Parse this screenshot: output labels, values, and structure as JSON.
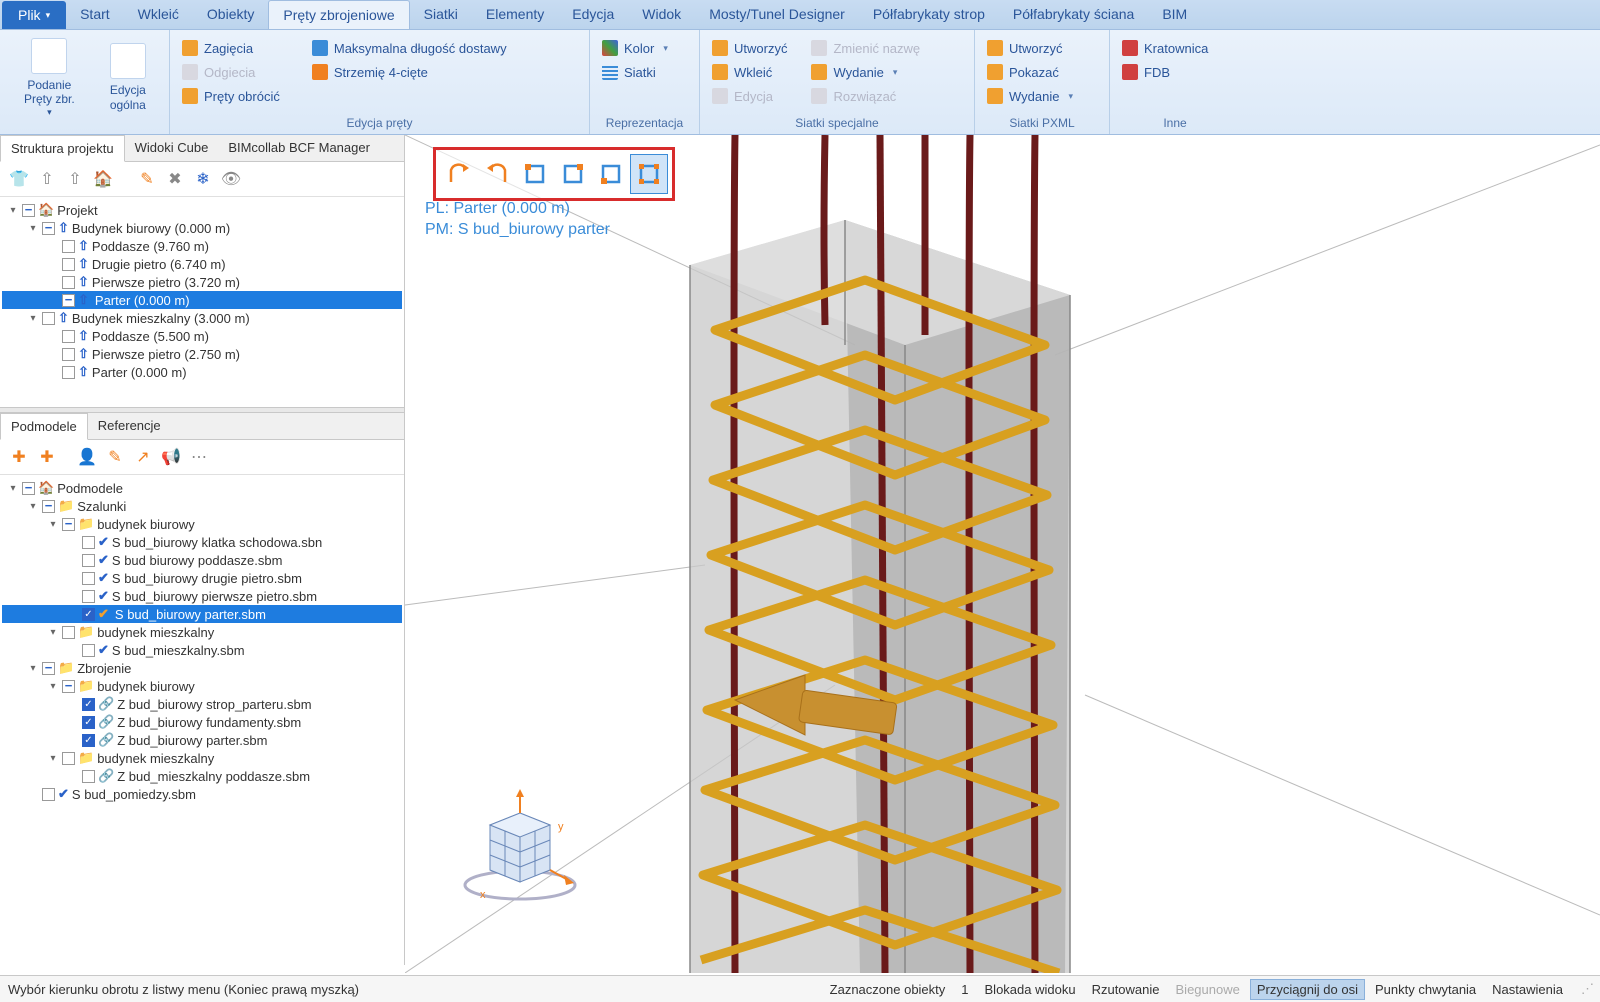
{
  "ribbon": {
    "file": "Plik",
    "tabs": [
      "Start",
      "Wkleić",
      "Obiekty",
      "Pręty zbrojeniowe",
      "Siatki",
      "Elementy",
      "Edycja",
      "Widok",
      "Mosty/Tunel Designer",
      "Półfabrykaty strop",
      "Półfabrykaty ściana",
      "BIM"
    ],
    "active_tab": 3,
    "groups": {
      "g1": {
        "label": "",
        "btn1": "Podanie\nPręty zbr.",
        "btn2": "Edycja\nogólna"
      },
      "g2": {
        "label": "Edycja pręty",
        "a": "Zagięcia",
        "b": "Odgiecia",
        "c": "Pręty obrócić",
        "d": "Maksymalna długość dostawy",
        "e": "Strzemię 4-cięte"
      },
      "g3": {
        "label": "Reprezentacja",
        "a": "Kolor",
        "b": "Siatki"
      },
      "g4": {
        "label": "Siatki specjalne",
        "a": "Utworzyć",
        "b": "Wkleić",
        "c": "Edycja",
        "d": "Zmienić nazwę",
        "e": "Wydanie",
        "f": "Rozwiązać"
      },
      "g5": {
        "label": "Siatki PXML",
        "a": "Utworzyć",
        "b": "Pokazać",
        "c": "Wydanie"
      },
      "g6": {
        "label": "Inne",
        "a": "Kratownica",
        "b": "FDB"
      }
    }
  },
  "struct_panel": {
    "tabs": [
      "Struktura projektu",
      "Widoki Cube",
      "BIMcollab BCF Manager"
    ],
    "tree": [
      {
        "lvl": 0,
        "caret": "▾",
        "chk": "minus",
        "icon": "home",
        "text": "Projekt"
      },
      {
        "lvl": 1,
        "caret": "▾",
        "chk": "minus",
        "icon": "arrow",
        "text": "Budynek biurowy (0.000 m)"
      },
      {
        "lvl": 2,
        "caret": "",
        "chk": "",
        "icon": "arrow",
        "text": "Poddasze (9.760 m)"
      },
      {
        "lvl": 2,
        "caret": "",
        "chk": "",
        "icon": "arrow",
        "text": "Drugie pietro (6.740 m)"
      },
      {
        "lvl": 2,
        "caret": "",
        "chk": "",
        "icon": "arrow",
        "text": "Pierwsze pietro (3.720 m)"
      },
      {
        "lvl": 2,
        "caret": "",
        "chk": "minus",
        "icon": "arrow",
        "text": "Parter (0.000 m)",
        "selected": true
      },
      {
        "lvl": 1,
        "caret": "▾",
        "chk": "",
        "icon": "arrow",
        "text": "Budynek mieszkalny (3.000 m)"
      },
      {
        "lvl": 2,
        "caret": "",
        "chk": "",
        "icon": "arrow",
        "text": "Poddasze (5.500 m)"
      },
      {
        "lvl": 2,
        "caret": "",
        "chk": "",
        "icon": "arrow",
        "text": "Pierwsze pietro (2.750 m)"
      },
      {
        "lvl": 2,
        "caret": "",
        "chk": "",
        "icon": "arrow",
        "text": "Parter (0.000 m)"
      }
    ]
  },
  "sub_panel": {
    "tabs": [
      "Podmodele",
      "Referencje"
    ],
    "tree": [
      {
        "lvl": 0,
        "caret": "▾",
        "chk": "minus",
        "icon": "home",
        "text": "Podmodele"
      },
      {
        "lvl": 1,
        "caret": "▾",
        "chk": "minus",
        "icon": "folder",
        "text": "Szalunki"
      },
      {
        "lvl": 2,
        "caret": "▾",
        "chk": "minus",
        "icon": "folder",
        "text": "budynek biurowy"
      },
      {
        "lvl": 3,
        "caret": "",
        "chk": "",
        "icon": "check-b",
        "text": "S bud_biurowy klatka schodowa.sbn"
      },
      {
        "lvl": 3,
        "caret": "",
        "chk": "",
        "icon": "check-b",
        "text": "S bud biurowy poddasze.sbm"
      },
      {
        "lvl": 3,
        "caret": "",
        "chk": "",
        "icon": "check-b",
        "text": "S bud_biurowy drugie pietro.sbm"
      },
      {
        "lvl": 3,
        "caret": "",
        "chk": "",
        "icon": "check-b",
        "text": "S bud_biurowy pierwsze pietro.sbm"
      },
      {
        "lvl": 3,
        "caret": "",
        "chk": "blue",
        "icon": "check-o",
        "text": "S bud_biurowy parter.sbm",
        "selected": true
      },
      {
        "lvl": 2,
        "caret": "▾",
        "chk": "",
        "icon": "folder",
        "text": "budynek mieszkalny"
      },
      {
        "lvl": 3,
        "caret": "",
        "chk": "",
        "icon": "check-b",
        "text": "S bud_mieszkalny.sbm"
      },
      {
        "lvl": 1,
        "caret": "▾",
        "chk": "minus",
        "icon": "folder",
        "text": "Zbrojenie"
      },
      {
        "lvl": 2,
        "caret": "▾",
        "chk": "minus",
        "icon": "folder",
        "text": "budynek biurowy"
      },
      {
        "lvl": 3,
        "caret": "",
        "chk": "blue",
        "icon": "link",
        "text": "Z bud_biurowy strop_parteru.sbm"
      },
      {
        "lvl": 3,
        "caret": "",
        "chk": "blue",
        "icon": "link",
        "text": "Z bud_biurowy fundamenty.sbm"
      },
      {
        "lvl": 3,
        "caret": "",
        "chk": "blue",
        "icon": "link",
        "text": "Z bud_biurowy parter.sbm"
      },
      {
        "lvl": 2,
        "caret": "▾",
        "chk": "",
        "icon": "folder",
        "text": "budynek mieszkalny"
      },
      {
        "lvl": 3,
        "caret": "",
        "chk": "",
        "icon": "link",
        "text": "Z bud_mieszkalny poddasze.sbm"
      },
      {
        "lvl": 1,
        "caret": "",
        "chk": "",
        "icon": "check-b",
        "text": "S bud_pomiedzy.sbm"
      }
    ]
  },
  "viewport": {
    "line1": "PL: Parter (0.000 m)",
    "line2": "PM: S bud_biurowy parter"
  },
  "status": {
    "left": "Wybór kierunku obrotu z listwy menu (Koniec prawą myszką)",
    "items": [
      "Zaznaczone obiekty",
      "1",
      "Blokada widoku",
      "Rzutowanie",
      "Biegunowe",
      "Przyciągnij do osi",
      "Punkty chwytania",
      "Nastawienia"
    ],
    "active_index": 5,
    "disabled_index": 4
  }
}
